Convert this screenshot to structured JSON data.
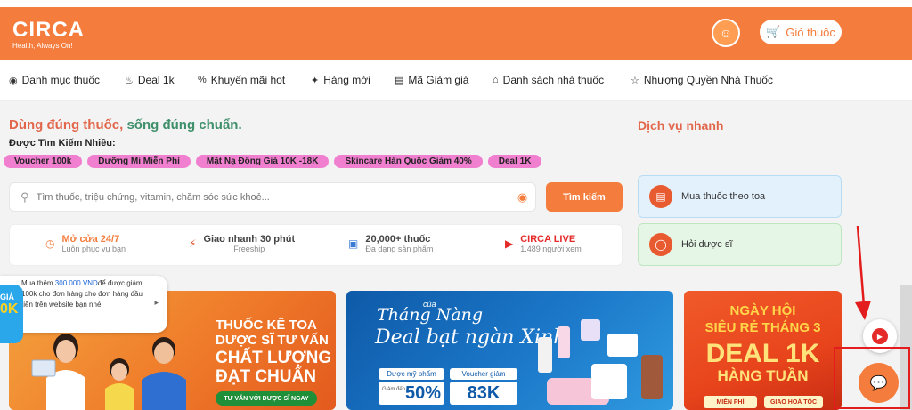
{
  "header": {
    "logo_text": "CIRCA",
    "logo_tagline": "Health, Always On!",
    "cart_label": "Giỏ thuốc"
  },
  "nav": [
    {
      "label": "Danh mục thuốc",
      "icon": "pill-icon"
    },
    {
      "label": "Deal 1k",
      "icon": "flame-icon"
    },
    {
      "label": "Khuyến mãi hot",
      "icon": "percent-icon"
    },
    {
      "label": "Hàng mới",
      "icon": "sparkle-icon"
    },
    {
      "label": "Mã Giảm giá",
      "icon": "ticket-icon"
    },
    {
      "label": "Danh sách nhà thuốc",
      "icon": "store-icon"
    },
    {
      "label": "Nhượng Quyền Nhà Thuốc",
      "icon": "handshake-icon"
    }
  ],
  "hero": {
    "tagline_part1": "Dùng đúng thuốc, ",
    "tagline_part2": "sống đúng chuẩn.",
    "popular_label": "Được Tìm Kiếm Nhiều:"
  },
  "chips": [
    "Voucher 100k",
    "Dưỡng Mi Miễn Phí",
    "Mặt Nạ Đồng Giá 10K -18K",
    "Skincare Hàn Quốc Giảm 40%",
    "Deal 1K"
  ],
  "search": {
    "placeholder": "Tìm thuốc, triệu chứng, vitamin, chăm sóc sức khoẻ...",
    "button": "Tìm kiếm"
  },
  "features": [
    {
      "title": "Mở cửa 24/7",
      "sub": "Luôn phục vụ bạn",
      "color": "#f47c3c",
      "icon": "clock-icon"
    },
    {
      "title": "Giao nhanh 30 phút",
      "sub": "Freeship",
      "color": "#444444",
      "icon": "lightning-icon"
    },
    {
      "title": "20,000+ thuốc",
      "sub": "Đa dạng sản phẩm",
      "color": "#444444",
      "icon": "box-icon"
    },
    {
      "title": "CIRCA LIVE",
      "sub": "1.489 người xem",
      "color": "#e52a2a",
      "icon": "live-icon"
    }
  ],
  "services": {
    "title": "Dịch vụ nhanh",
    "items": [
      {
        "label": "Mua thuốc theo toa",
        "bg": "#e3f1fc",
        "border": "#b9dcf5",
        "icon": "document-icon"
      },
      {
        "label": "Hỏi dược sĩ",
        "bg": "#e6f6e6",
        "border": "#bfe6bf",
        "icon": "chat-icon"
      }
    ]
  },
  "banners": {
    "b1": {
      "line1": "THUỐC KÊ TOA",
      "line2": "DƯỢC SĨ TƯ VẤN",
      "line3": "CHẤT LƯỢNG",
      "line4": "ĐẠT CHUẨN",
      "cta": "TƯ VẤN VỚI DƯỢC SĨ NGAY"
    },
    "b2": {
      "small": "của",
      "script1": "Tháng Nàng",
      "script2": "Deal bạt ngàn Xinh",
      "tag1": "Dược mỹ phẩm",
      "tag2": "Voucher giảm",
      "val1_prefix": "Giảm đến",
      "val1": "50%",
      "val2": "83K"
    },
    "b3": {
      "line1": "NGÀY HỘI",
      "line2": "SIÊU RẺ THÁNG 3",
      "line3": "DEAL 1K",
      "line4": "HÀNG TUẦN",
      "tag1": "MIỄN PHÍ",
      "tag2": "GIAO HOẢ TỐC"
    }
  },
  "promo": {
    "text_before": "Mua thêm ",
    "amount": "300.000 VND",
    "text_after": "để được giảm 100k cho đơn hàng cho đơn hàng đầu tiên trên website bạn nhé!",
    "badge_top": "GIẢ",
    "badge_big": "0K"
  },
  "colors": {
    "brand": "#f47c3c",
    "highlight": "#e31d1d"
  }
}
